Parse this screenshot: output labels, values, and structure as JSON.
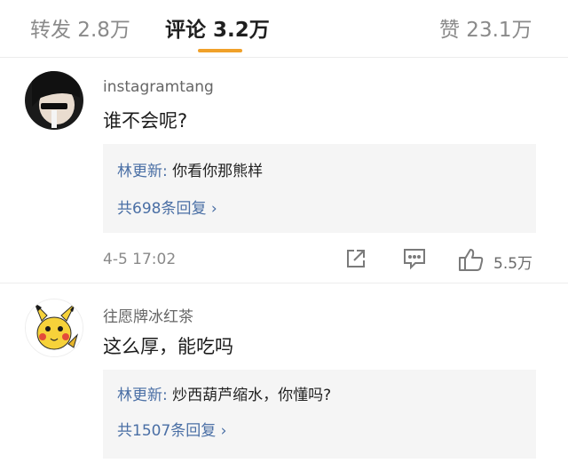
{
  "tabs": {
    "repost": "转发 2.8万",
    "comments": "评论 3.2万",
    "likes": "赞 23.1万"
  },
  "comments": [
    {
      "username": "instagramtang",
      "text": "谁不会呢?",
      "reply": {
        "author": "林更新:",
        "text": " 你看你那熊样",
        "more": "共698条回复 ›"
      },
      "time": "4-5 17:02",
      "like_count": "5.5万"
    },
    {
      "username": "往愿牌冰红茶",
      "text": "这么厚，能吃吗",
      "reply": {
        "author": "林更新:",
        "text": " 炒西葫芦缩水，你懂吗?",
        "more": "共1507条回复 ›"
      }
    }
  ],
  "icons": {
    "share": "share-icon",
    "comment": "comment-icon",
    "like": "thumbs-up-icon"
  },
  "colors": {
    "accent_underline": "#f0a12a",
    "link_blue": "#4a6fa5",
    "reply_bg": "#f5f5f5"
  }
}
